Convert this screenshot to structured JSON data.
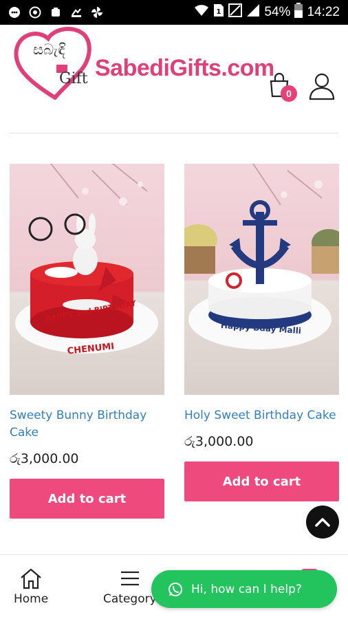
{
  "status_bar": {
    "battery": "54%",
    "time": "14:22"
  },
  "header": {
    "brand": "SabediGifts.com",
    "logo_script": "සබැඳි",
    "logo_gift": "Gift",
    "cart_count": "0"
  },
  "products": [
    {
      "name": "Sweety Bunny Birthday Cake",
      "price": "රු3,000.00",
      "button": "Add to cart",
      "cake_text_line1": "HAPPY 2nd BIRTHDAY",
      "cake_text_line2": "CHENUMI"
    },
    {
      "name": "Holy Sweet Birthday Cake",
      "price": "රු3,000.00",
      "button": "Add to cart",
      "cake_text_line1": "Happy Bday Malli"
    }
  ],
  "bottom_nav": {
    "home": "Home",
    "category": "Category"
  },
  "whatsapp": {
    "label": "Hi, how can I help?"
  },
  "colors": {
    "accent": "#ef4a7e",
    "link": "#2f7fc1",
    "whatsapp": "#23c35e"
  }
}
